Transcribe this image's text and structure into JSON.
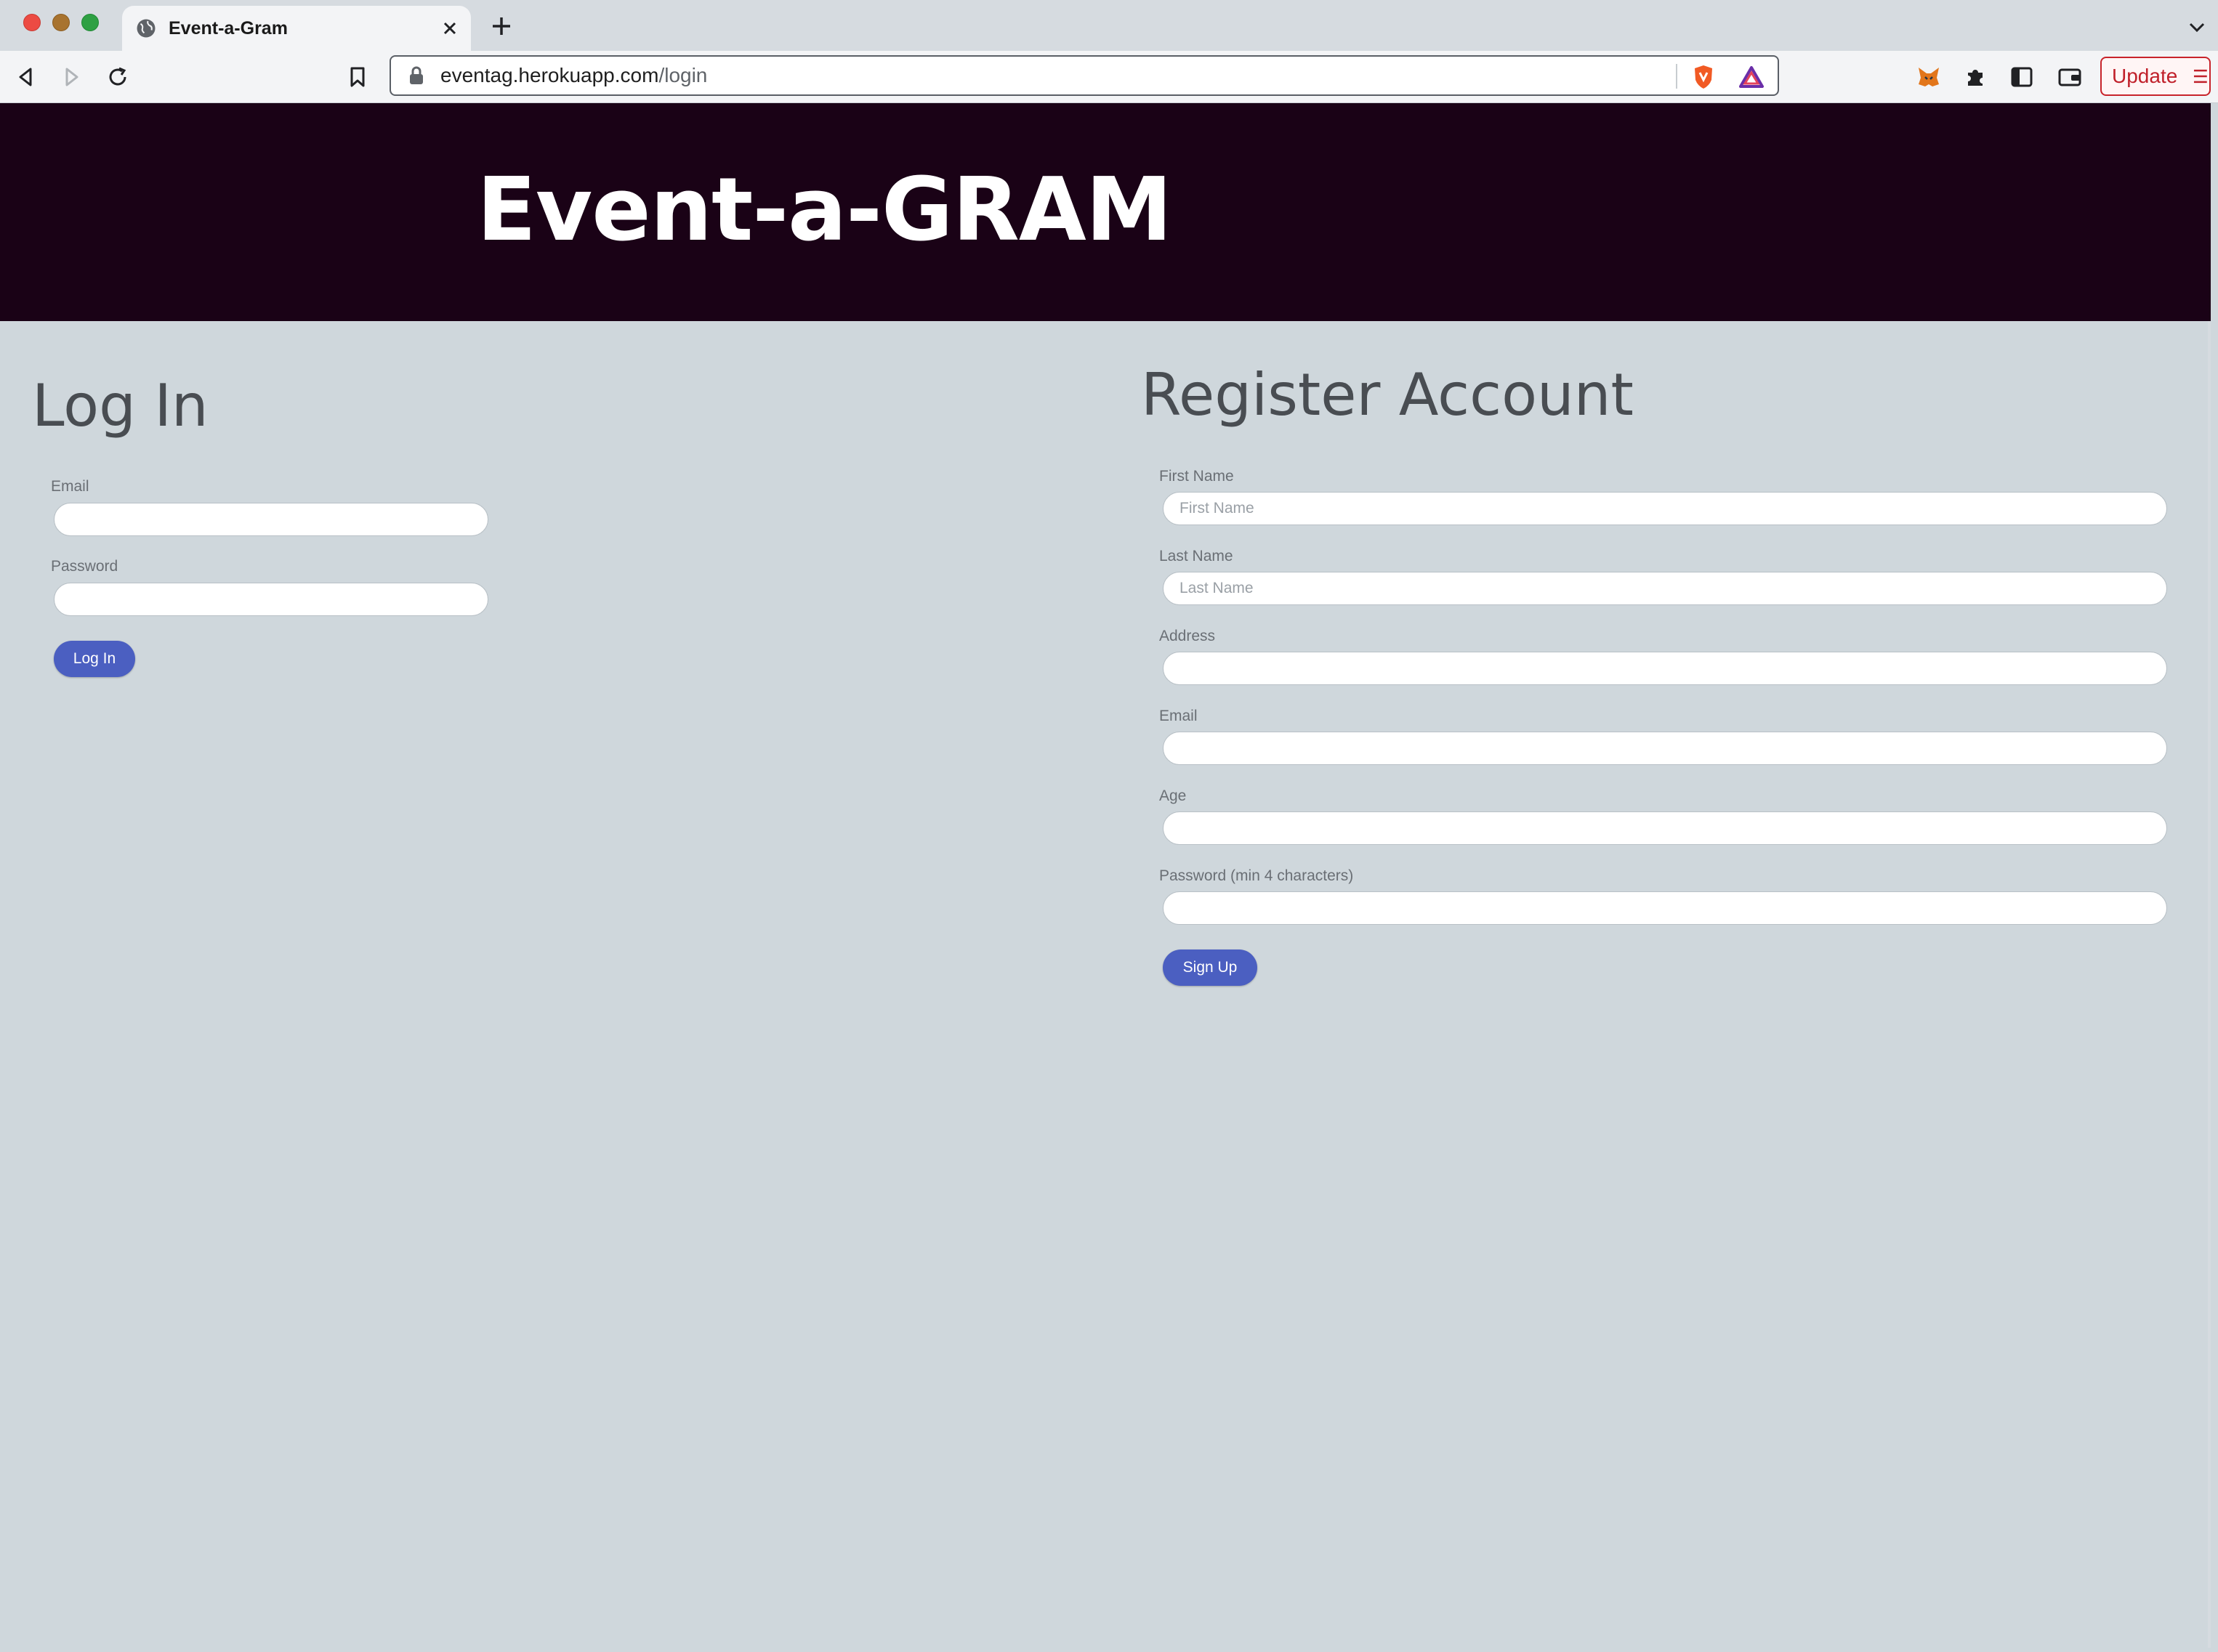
{
  "browser": {
    "tab": {
      "title": "Event-a-Gram"
    },
    "url": {
      "host": "eventag.herokuapp.com",
      "path": "/login"
    },
    "update_label": "Update"
  },
  "hero": {
    "title": "Event-a-GRAM"
  },
  "login": {
    "title": "Log In",
    "email_label": "Email",
    "email_value": "",
    "password_label": "Password",
    "password_value": "",
    "submit_label": "Log In"
  },
  "register": {
    "title": "Register Account",
    "first_name_label": "First Name",
    "first_name_placeholder": "First Name",
    "last_name_label": "Last Name",
    "last_name_placeholder": "Last Name",
    "address_label": "Address",
    "email_label": "Email",
    "age_label": "Age",
    "password_label": "Password (min 4 characters)",
    "submit_label": "Sign Up"
  },
  "colors": {
    "hero_bg": "#1a0216",
    "page_bg": "#cfd7dc",
    "button_bg": "#4b5fc1",
    "update_accent": "#c0202a"
  }
}
